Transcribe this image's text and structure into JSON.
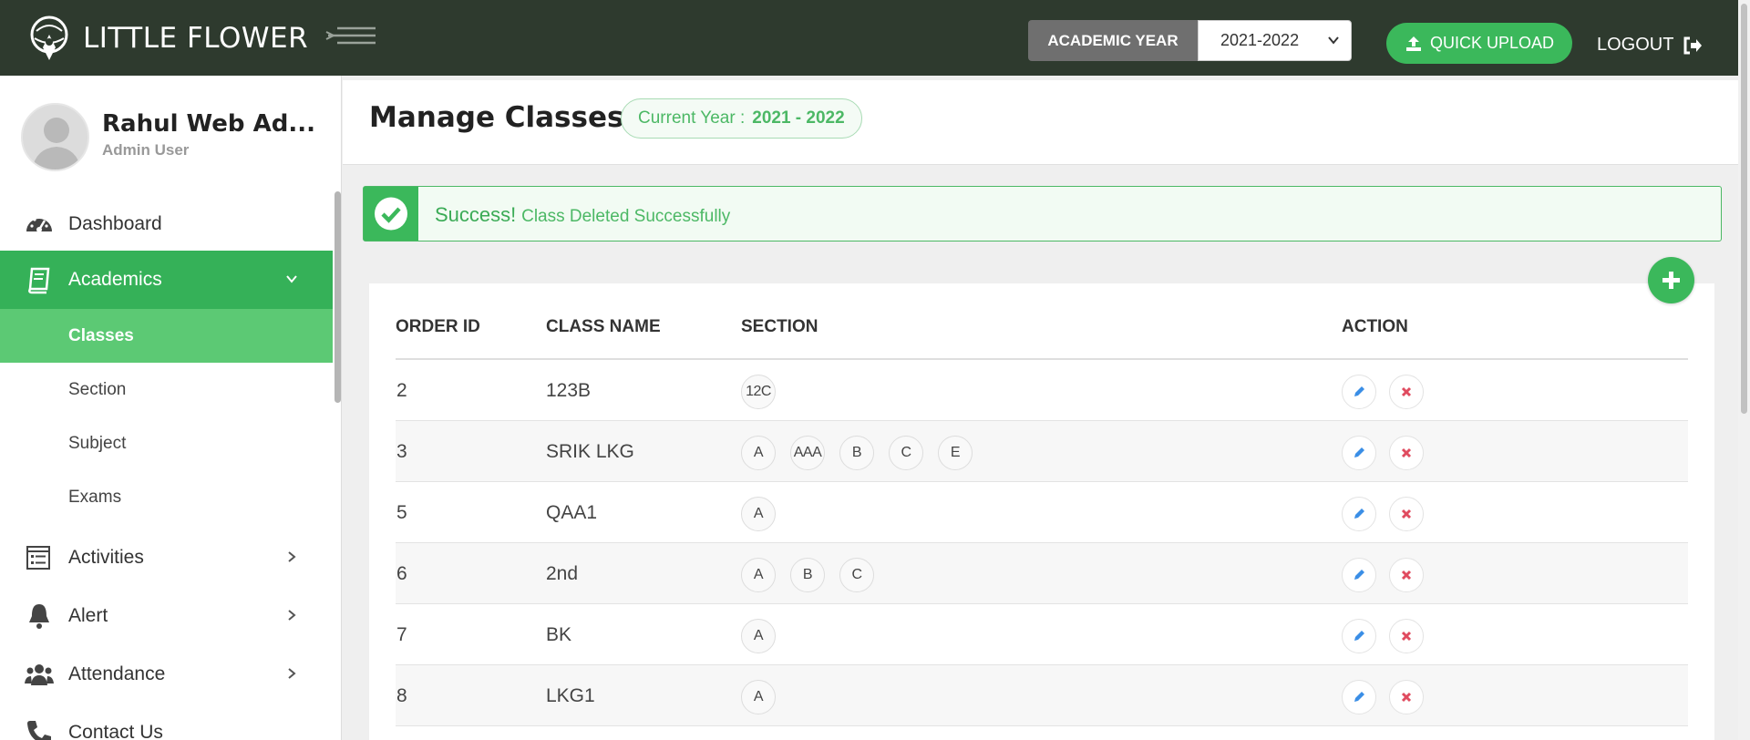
{
  "header": {
    "brand": "LITTLE FLOWER",
    "academic_year_label": "ACADEMIC YEAR",
    "academic_year_value": "2021-2022",
    "quick_upload_label": "QUICK UPLOAD",
    "logout_label": "LOGOUT"
  },
  "user": {
    "name": "Rahul Web Ad...",
    "role": "Admin User"
  },
  "sidebar": {
    "dashboard": "Dashboard",
    "academics": "Academics",
    "classes": "Classes",
    "section": "Section",
    "subject": "Subject",
    "exams": "Exams",
    "activities": "Activities",
    "alert": "Alert",
    "attendance": "Attendance",
    "contact": "Contact Us"
  },
  "page": {
    "title": "Manage Classes",
    "current_year_label": "Current Year :",
    "current_year_value": "2021 - 2022"
  },
  "alert": {
    "strong": "Success!",
    "message": "Class Deleted Successfully"
  },
  "table": {
    "columns": {
      "order_id": "ORDER ID",
      "class_name": "CLASS NAME",
      "section": "SECTION",
      "action": "ACTION"
    },
    "rows": [
      {
        "order_id": "2",
        "class_name": "123B",
        "sections": [
          "12C"
        ]
      },
      {
        "order_id": "3",
        "class_name": "SRIK LKG",
        "sections": [
          "A",
          "AAA",
          "B",
          "C",
          "E"
        ]
      },
      {
        "order_id": "5",
        "class_name": "QAA1",
        "sections": [
          "A"
        ]
      },
      {
        "order_id": "6",
        "class_name": "2nd",
        "sections": [
          "A",
          "B",
          "C"
        ]
      },
      {
        "order_id": "7",
        "class_name": "BK",
        "sections": [
          "A"
        ]
      },
      {
        "order_id": "8",
        "class_name": "LKG1",
        "sections": [
          "A"
        ]
      }
    ]
  },
  "colors": {
    "topbar": "#2e3a2e",
    "accent_green": "#3bb85b",
    "edit_blue": "#3a8ee6",
    "delete_red": "#e04b5f"
  }
}
